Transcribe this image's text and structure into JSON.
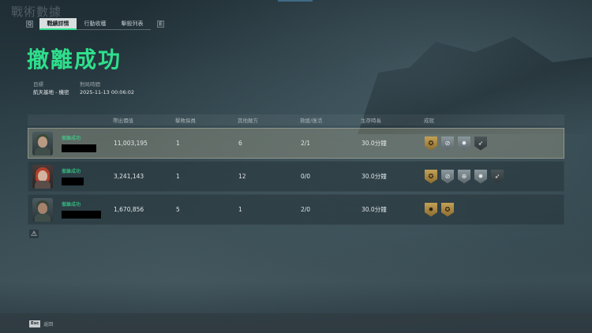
{
  "window": {
    "corner_title": "戰術數據"
  },
  "tabs": {
    "prev_key": "Q",
    "next_key": "E",
    "items": [
      {
        "label": "戰績詳情",
        "active": true
      },
      {
        "label": "行動收穫",
        "active": false
      },
      {
        "label": "擊殺列表",
        "active": false
      }
    ]
  },
  "result": {
    "title": "撤離成功"
  },
  "meta": {
    "target_label": "目標",
    "target_value": "航天基地 - 機密",
    "time_label": "對局時間",
    "time_value": "2025-11-13 00:06:02"
  },
  "table": {
    "headers": {
      "value": "帶出價值",
      "kills": "擊敗探員",
      "other": "其他敵方",
      "rescue": "救援/復活",
      "time": "生存時長",
      "achievements": "成就"
    },
    "rows": [
      {
        "status": "撤離成功",
        "value": "11,003,195",
        "kills": "1",
        "other": "6",
        "rescue": "2/1",
        "time": "30.0分鐘",
        "highlight": true,
        "avatar": "soldier-avatar",
        "achievements": [
          {
            "icon": "gold-medal-icon",
            "glyph": "✪",
            "tier": "gold"
          },
          {
            "icon": "crossed-circle-icon",
            "glyph": "⊘",
            "tier": "silver"
          },
          {
            "icon": "star-burst-icon",
            "glyph": "✸",
            "tier": "silver"
          },
          {
            "icon": "rifle-icon",
            "glyph": "➶",
            "tier": "dark"
          }
        ]
      },
      {
        "status": "撤離成功",
        "value": "3,241,143",
        "kills": "1",
        "other": "12",
        "rescue": "0/0",
        "time": "30.0分鐘",
        "highlight": false,
        "avatar": "redhead-avatar",
        "achievements": [
          {
            "icon": "gold-medal-icon",
            "glyph": "✪",
            "tier": "gold"
          },
          {
            "icon": "crossed-circle-icon",
            "glyph": "⊘",
            "tier": "silver"
          },
          {
            "icon": "crosshair-icon",
            "glyph": "⊕",
            "tier": "silver"
          },
          {
            "icon": "star-burst-icon",
            "glyph": "✸",
            "tier": "silver"
          },
          {
            "icon": "rifle-icon",
            "glyph": "➶",
            "tier": "dark"
          }
        ]
      },
      {
        "status": "撤離成功",
        "value": "1,670,856",
        "kills": "5",
        "other": "1",
        "rescue": "2/0",
        "time": "30.0分鐘",
        "highlight": false,
        "avatar": "helmet-avatar",
        "achievements": [
          {
            "icon": "burst-medal-icon",
            "glyph": "✹",
            "tier": "gold"
          },
          {
            "icon": "gold-medal-icon",
            "glyph": "✪",
            "tier": "gold"
          }
        ]
      }
    ]
  },
  "footer": {
    "esc_key": "Esc",
    "esc_label": "返回",
    "warn_icon": "warning-icon",
    "warn_glyph": "⚠"
  },
  "colors": {
    "accent": "#2ee08c",
    "highlight_row": "#8f8f7c",
    "gold": "#c2a056"
  }
}
